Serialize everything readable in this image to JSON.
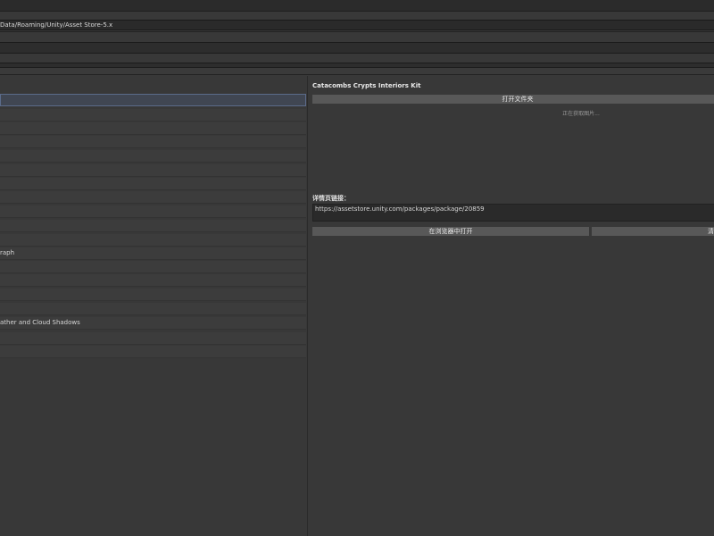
{
  "path": {
    "value": "Data/Roaming/Unity/Asset Store-5.x"
  },
  "list": {
    "rows": [
      {
        "label": "",
        "selected": true
      },
      {
        "label": ""
      },
      {
        "label": ""
      },
      {
        "label": ""
      },
      {
        "label": ""
      },
      {
        "label": ""
      },
      {
        "label": ""
      },
      {
        "label": ""
      },
      {
        "label": ""
      },
      {
        "label": ""
      },
      {
        "label": ""
      },
      {
        "label": "raph"
      },
      {
        "label": ""
      },
      {
        "label": ""
      },
      {
        "label": ""
      },
      {
        "label": ""
      },
      {
        "label": "ather and Cloud Shadows"
      },
      {
        "label": ""
      },
      {
        "label": ""
      }
    ]
  },
  "detail": {
    "title": "Catacombs Crypts Interiors Kit",
    "open_folder_label": "打开文件夹",
    "loading_text": "正在获取图片...",
    "link_label": "详情页链接：",
    "url": "https://assetstore.unity.com/packages/package/20859",
    "open_in_browser_label": "在浏览器中打开",
    "second_button_label": "清"
  }
}
